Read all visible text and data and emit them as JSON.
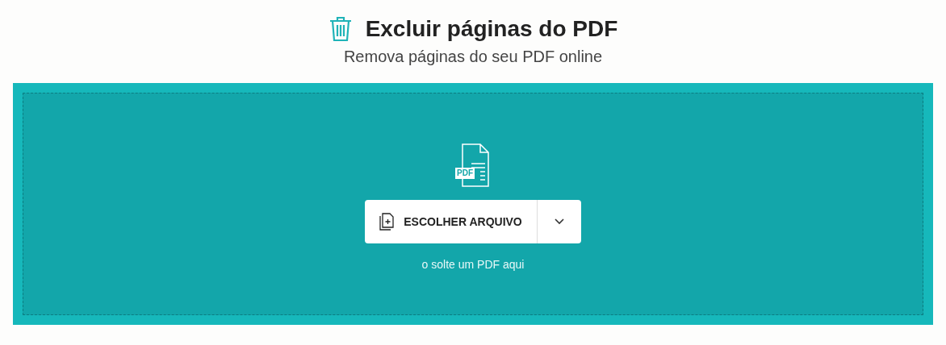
{
  "header": {
    "title": "Excluir páginas do PDF",
    "subtitle": "Remova páginas do seu PDF online"
  },
  "dropzone": {
    "file_icon_label": "PDF",
    "button": {
      "label": "ESCOLHER ARQUIVO"
    },
    "hint": "o solte um PDF aqui"
  }
}
